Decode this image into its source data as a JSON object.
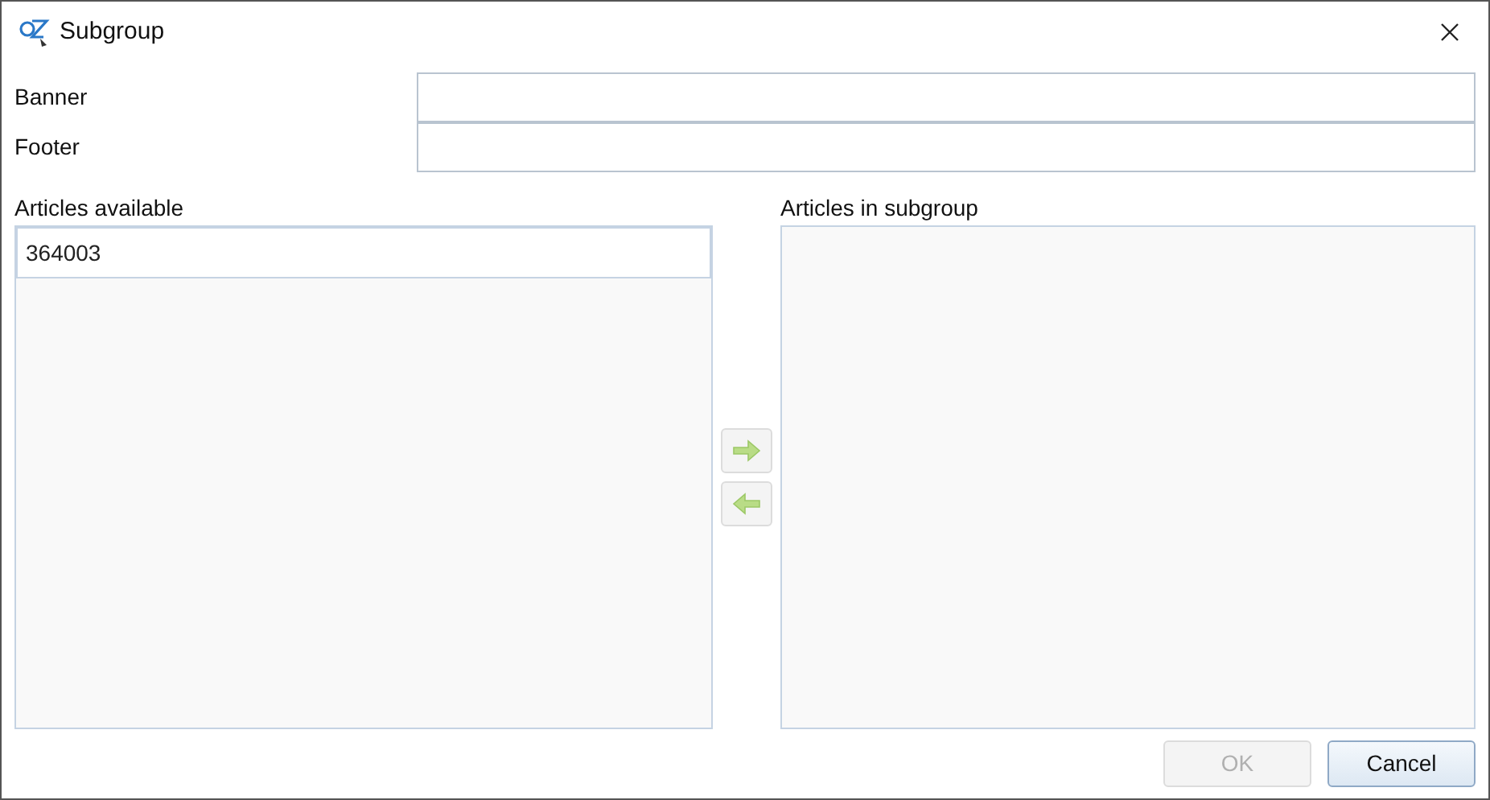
{
  "window": {
    "title": "Subgroup"
  },
  "fields": [
    {
      "label": "Banner"
    },
    {
      "label": "Footer"
    }
  ],
  "available": {
    "label": "Articles available",
    "items": [
      {
        "text": "364003",
        "selected": true
      }
    ]
  },
  "move_buttons": [
    {
      "kind": "right",
      "disabled": true
    },
    {
      "kind": "left",
      "disabled": true
    }
  ],
  "in_subgroup": {
    "label": "Articles in subgroup"
  },
  "buttons": [
    {
      "label": "OK",
      "disabled": true
    },
    {
      "label": "Cancel",
      "disabled": false
    }
  ]
}
